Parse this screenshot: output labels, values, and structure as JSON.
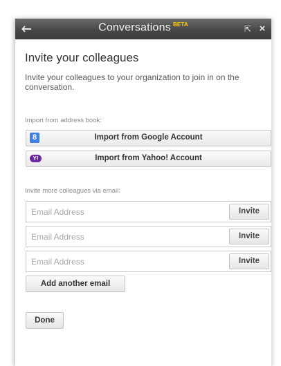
{
  "window": {
    "title": "Conversations",
    "beta_badge": "BETA",
    "icons": {
      "back": "back-arrow-icon",
      "popout": "popout-icon",
      "close": "close-icon"
    }
  },
  "heading": "Invite your colleagues",
  "intro": "Invite your colleagues to your organization to join in on the conversation.",
  "import_section": {
    "label": "Import from address book:",
    "google": {
      "label": "Import from Google Account",
      "icon": "google-icon",
      "glyph": "8"
    },
    "yahoo": {
      "label": "Import from Yahoo! Account",
      "icon": "yahoo-icon",
      "glyph": "Y!"
    }
  },
  "email_section": {
    "label": "Invite more colleagues via email:",
    "rows": [
      {
        "placeholder": "Email Address",
        "value": "",
        "button": "Invite"
      },
      {
        "placeholder": "Email Address",
        "value": "",
        "button": "Invite"
      },
      {
        "placeholder": "Email Address",
        "value": "",
        "button": "Invite"
      }
    ],
    "add_another": "Add another email"
  },
  "done_label": "Done",
  "colors": {
    "titlebar": "#474747",
    "beta": "#ffcc00",
    "google_blue": "#3f7fe6",
    "yahoo_purple": "#6a2a9e"
  }
}
